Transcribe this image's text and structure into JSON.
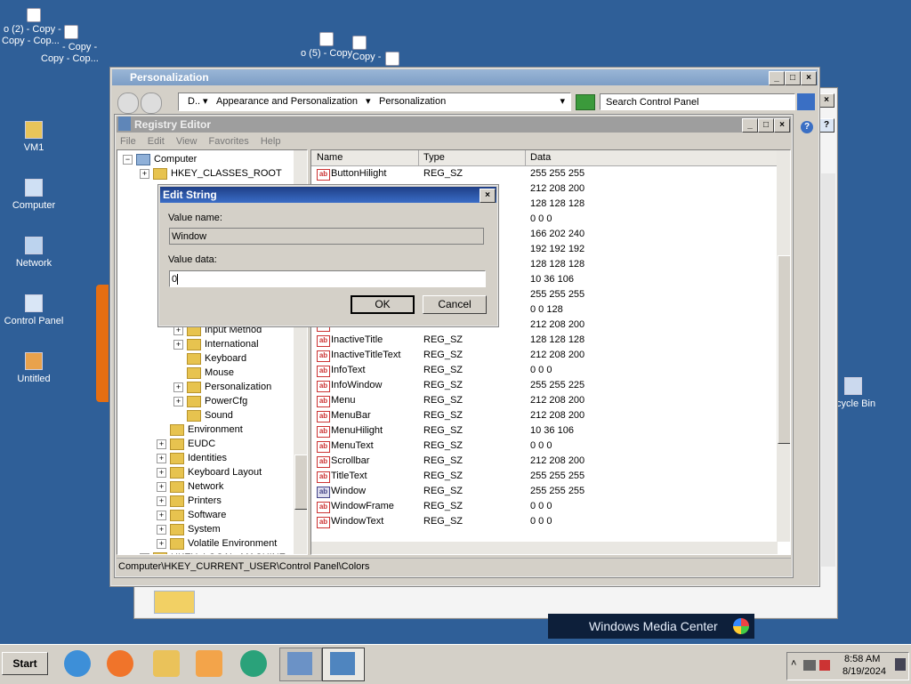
{
  "desktop": {
    "icons": [
      {
        "label": "VM1"
      },
      {
        "label": "Computer"
      },
      {
        "label": "Network"
      },
      {
        "label": "Control Panel"
      },
      {
        "label": "Untitled"
      },
      {
        "label": "ecycle Bin"
      }
    ],
    "stray_labels": [
      "o (2) - Copy -",
      "Copy - Cop...",
      "- Copy -",
      "Copy - Cop...",
      "o (5) - Copy",
      "Copy -",
      "o (2) -"
    ]
  },
  "personalization": {
    "title": "Personalization",
    "address": {
      "root": "D..",
      "crumb1": "Appearance and Personalization",
      "crumb2": "Personalization"
    },
    "search_placeholder": "Search Control Panel",
    "media_center": "Windows Media Center"
  },
  "regedit": {
    "title": "Registry Editor",
    "menu": [
      "File",
      "Edit",
      "View",
      "Favorites",
      "Help"
    ],
    "tree": [
      {
        "label": "Computer",
        "indent": 0,
        "pm": "−"
      },
      {
        "label": "HKEY_CLASSES_ROOT",
        "indent": 1,
        "pm": "+"
      },
      {
        "label": "Input Method",
        "indent": 3,
        "pm": "+"
      },
      {
        "label": "International",
        "indent": 3,
        "pm": "+"
      },
      {
        "label": "Keyboard",
        "indent": 3,
        "pm": ""
      },
      {
        "label": "Mouse",
        "indent": 3,
        "pm": ""
      },
      {
        "label": "Personalization",
        "indent": 3,
        "pm": "+"
      },
      {
        "label": "PowerCfg",
        "indent": 3,
        "pm": "+"
      },
      {
        "label": "Sound",
        "indent": 3,
        "pm": ""
      },
      {
        "label": "Environment",
        "indent": 2,
        "pm": ""
      },
      {
        "label": "EUDC",
        "indent": 2,
        "pm": "+"
      },
      {
        "label": "Identities",
        "indent": 2,
        "pm": "+"
      },
      {
        "label": "Keyboard Layout",
        "indent": 2,
        "pm": "+"
      },
      {
        "label": "Network",
        "indent": 2,
        "pm": "+"
      },
      {
        "label": "Printers",
        "indent": 2,
        "pm": "+"
      },
      {
        "label": "Software",
        "indent": 2,
        "pm": "+"
      },
      {
        "label": "System",
        "indent": 2,
        "pm": "+"
      },
      {
        "label": "Volatile Environment",
        "indent": 2,
        "pm": "+"
      },
      {
        "label": "HKEY_LOCAL_MACHINE",
        "indent": 1,
        "pm": "+"
      }
    ],
    "columns": {
      "name": "Name",
      "type": "Type",
      "data": "Data"
    },
    "rows": [
      {
        "name": "ButtonHilight",
        "type": "REG_SZ",
        "data": "255 255 255"
      },
      {
        "name": "",
        "type": "",
        "data": "212 208 200"
      },
      {
        "name": "",
        "type": "",
        "data": "128 128 128"
      },
      {
        "name": "",
        "type": "",
        "data": "0 0 0"
      },
      {
        "name": "",
        "type": "",
        "data": "166 202 240"
      },
      {
        "name": "",
        "type": "",
        "data": "192 192 192"
      },
      {
        "name": "",
        "type": "",
        "data": "128 128 128"
      },
      {
        "name": "",
        "type": "",
        "data": "10 36 106"
      },
      {
        "name": "",
        "type": "",
        "data": "255 255 255"
      },
      {
        "name": "",
        "type": "",
        "data": "0 0 128"
      },
      {
        "name": "",
        "type": "",
        "data": "212 208 200"
      },
      {
        "name": "InactiveTitle",
        "type": "REG_SZ",
        "data": "128 128 128"
      },
      {
        "name": "InactiveTitleText",
        "type": "REG_SZ",
        "data": "212 208 200"
      },
      {
        "name": "InfoText",
        "type": "REG_SZ",
        "data": "0 0 0"
      },
      {
        "name": "InfoWindow",
        "type": "REG_SZ",
        "data": "255 255 225"
      },
      {
        "name": "Menu",
        "type": "REG_SZ",
        "data": "212 208 200"
      },
      {
        "name": "MenuBar",
        "type": "REG_SZ",
        "data": "212 208 200"
      },
      {
        "name": "MenuHilight",
        "type": "REG_SZ",
        "data": "10 36 106"
      },
      {
        "name": "MenuText",
        "type": "REG_SZ",
        "data": "0 0 0"
      },
      {
        "name": "Scrollbar",
        "type": "REG_SZ",
        "data": "212 208 200"
      },
      {
        "name": "TitleText",
        "type": "REG_SZ",
        "data": "255 255 255"
      },
      {
        "name": "Window",
        "type": "REG_SZ",
        "data": "255 255 255",
        "binary": true
      },
      {
        "name": "WindowFrame",
        "type": "REG_SZ",
        "data": "0 0 0"
      },
      {
        "name": "WindowText",
        "type": "REG_SZ",
        "data": "0 0 0"
      }
    ],
    "status": "Computer\\HKEY_CURRENT_USER\\Control Panel\\Colors"
  },
  "dialog": {
    "title": "Edit String",
    "value_name_label": "Value name:",
    "value_name": "Window",
    "value_data_label": "Value data:",
    "value_data": "0",
    "ok": "OK",
    "cancel": "Cancel"
  },
  "taskbar": {
    "start": "Start",
    "time": "8:58 AM",
    "date": "8/19/2024"
  }
}
